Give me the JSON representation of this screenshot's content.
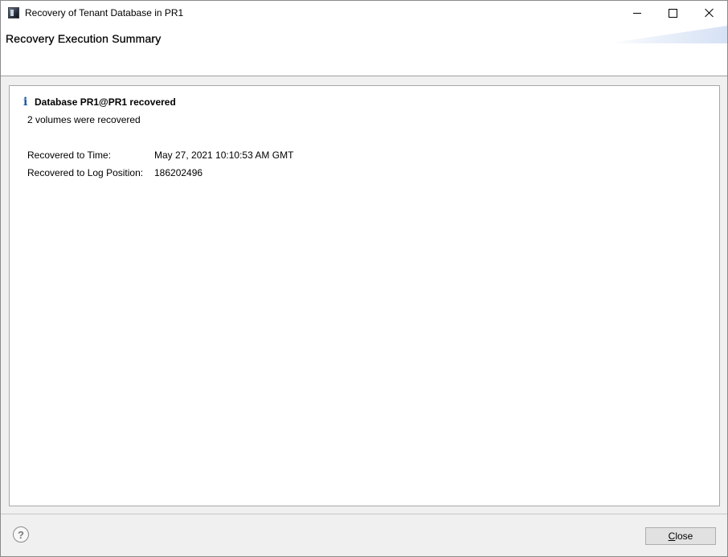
{
  "window": {
    "title": "Recovery of Tenant Database in PR1",
    "icon": "sap-hana-studio-icon"
  },
  "header": {
    "title": "Recovery Execution Summary"
  },
  "summary": {
    "status_icon": "info-icon",
    "status_title": "Database PR1@PR1 recovered",
    "status_subtitle": "2 volumes were recovered",
    "details": [
      {
        "label": "Recovered to Time:",
        "value": "May 27, 2021 10:10:53 AM GMT"
      },
      {
        "label": "Recovered to Log Position:",
        "value": "186202496"
      }
    ]
  },
  "footer": {
    "help_icon": "help-icon",
    "close_mnemonic": "C",
    "close_rest": "lose"
  },
  "colors": {
    "info_icon": "#1a56a8",
    "banner_accent": "#d5e1f4"
  }
}
